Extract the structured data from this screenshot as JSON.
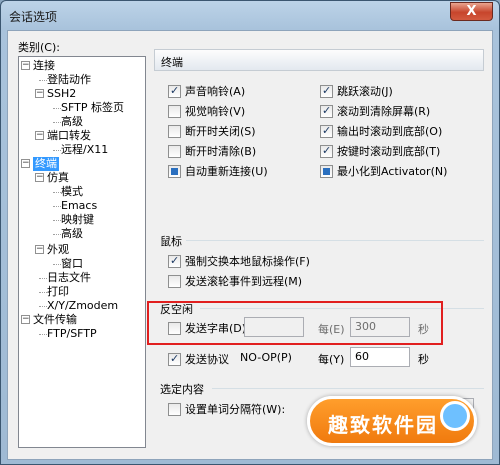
{
  "window": {
    "title": "会话选项",
    "close_label": "X"
  },
  "category_label": "类别(C):",
  "tree": [
    {
      "label": "连接",
      "expander": "−"
    },
    {
      "label": "登陆动作"
    },
    {
      "label": "SSH2",
      "expander": "−"
    },
    {
      "label": "SFTP 标签页"
    },
    {
      "label": "高级"
    },
    {
      "label": "端口转发",
      "expander": "−"
    },
    {
      "label": "远程/X11"
    },
    {
      "label": "终端",
      "expander": "−",
      "selected": true
    },
    {
      "label": "仿真",
      "expander": "−"
    },
    {
      "label": "模式"
    },
    {
      "label": "Emacs"
    },
    {
      "label": "映射键"
    },
    {
      "label": "高级"
    },
    {
      "label": "外观",
      "expander": "−"
    },
    {
      "label": "窗口"
    },
    {
      "label": "日志文件"
    },
    {
      "label": "打印"
    },
    {
      "label": "X/Y/Zmodem"
    },
    {
      "label": "文件传输",
      "expander": "−"
    },
    {
      "label": "FTP/SFTP"
    }
  ],
  "panel_title": "终端",
  "terminal_options": [
    {
      "label": "声音响铃(A)",
      "checked": true
    },
    {
      "label": "跳跃滚动(J)",
      "checked": true
    },
    {
      "label": "视觉响铃(V)",
      "checked": false
    },
    {
      "label": "滚动到清除屏幕(R)",
      "checked": true
    },
    {
      "label": "断开时关闭(S)",
      "checked": false
    },
    {
      "label": "输出时滚动到底部(O)",
      "checked": true
    },
    {
      "label": "断开时清除(B)",
      "checked": false
    },
    {
      "label": "按键时滚动到底部(T)",
      "checked": true
    },
    {
      "label": "自动重新连接(U)",
      "checked": true,
      "filled": true
    },
    {
      "label": "最小化到Activator(N)",
      "checked": true,
      "filled": true
    }
  ],
  "mouse": {
    "title": "鼠标",
    "options": [
      {
        "label": "强制交换本地鼠标操作(F)",
        "checked": true
      },
      {
        "label": "发送滚轮事件到远程(M)",
        "checked": false
      }
    ]
  },
  "anti_idle": {
    "title": "反空闲",
    "send_string": {
      "label": "发送字串(D):",
      "checked": false,
      "value": "",
      "every_label": "每(E)",
      "interval": "300",
      "unit": "秒"
    },
    "send_protocol": {
      "label": "发送协议",
      "protocol": "NO-OP(P)",
      "checked": true,
      "every_label": "每(Y)",
      "interval": "60",
      "unit": "秒"
    }
  },
  "select": {
    "title": "选定内容",
    "word_delim": {
      "label": "设置单词分隔符(W):",
      "checked": false,
      "value": ""
    }
  },
  "watermark": "趣致软件园"
}
